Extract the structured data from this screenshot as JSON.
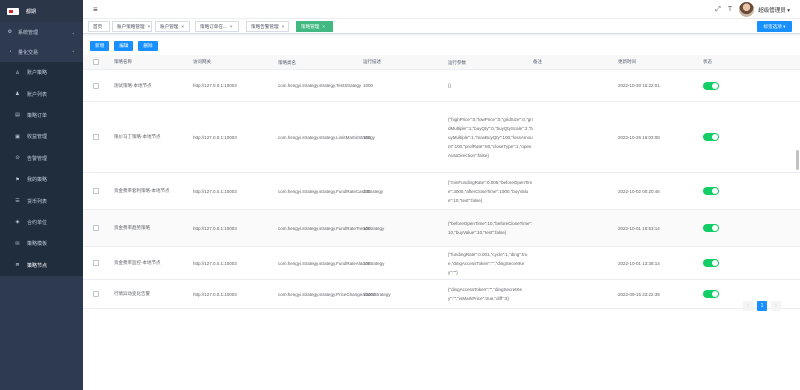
{
  "app": {
    "title": "都期"
  },
  "sidebar": {
    "groups": [
      {
        "label": "系统管理",
        "icon": "gear-icon"
      },
      {
        "label": "量化交易",
        "icon": "chart-icon"
      }
    ],
    "items": [
      {
        "label": "账户策略",
        "icon": "user-icon"
      },
      {
        "label": "账户列表",
        "icon": "user-list-icon"
      },
      {
        "label": "策略订单",
        "icon": "order-icon"
      },
      {
        "label": "收益管理",
        "icon": "money-icon"
      },
      {
        "label": "告警管理",
        "icon": "alarm-icon"
      },
      {
        "label": "我的策略",
        "icon": "strategy-icon"
      },
      {
        "label": "货币列表",
        "icon": "coin-icon"
      },
      {
        "label": "合约单位",
        "icon": "contract-icon"
      },
      {
        "label": "策略模板",
        "icon": "template-icon"
      },
      {
        "label": "策略节点",
        "icon": "node-icon"
      }
    ]
  },
  "navbar": {
    "username": "超级管理员",
    "user_arrow": "▾"
  },
  "tags": {
    "items": [
      {
        "label": "首页",
        "close": ""
      },
      {
        "label": "账户策略管理",
        "close": "×"
      },
      {
        "label": "账户管理",
        "close": "×"
      },
      {
        "label": "策略订单在...",
        "close": "×"
      },
      {
        "label": "策略告警管理",
        "close": "×"
      },
      {
        "label": "策略管理",
        "close": "×"
      }
    ],
    "select_label": "标签选项 ▾"
  },
  "toolbar": {
    "add": "新增",
    "edit": "编辑",
    "delete": "删除"
  },
  "table": {
    "headers": [
      "策略名称",
      "访问网关",
      "策略类名",
      "运行描述",
      "运行参数",
      "备注",
      "更新时间",
      "状态"
    ],
    "rows": [
      {
        "name": "测试策略-本地节点",
        "gateway": "http://127.0.0.1:10003",
        "clazz": "com.hengyi.strategy.strategy.TestStrategy",
        "desc": "1000",
        "params": "{}",
        "remark": "",
        "time": "2022-10-30 15:22:01"
      },
      {
        "name": "限价马丁策略-本地节点",
        "gateway": "http://127.0.0.1:10003",
        "clazz": "com.hengyi.strategy.strategy.LimitMartinStrategy",
        "desc": "100",
        "params": "{\"highPrice\":0,\"lowPrice\":0,\"gridSize\":0,\"gridMultiple\":1,\"buyQty\":0,\"buyQtyScale\":2,\"buyMultiple\":1,\"maxBuyQty\":100,\"lossAmount\":100,\"profRate\":50,\"closeType\":1,\"openAutoDirection\":false}",
        "remark": "",
        "time": "2022-10-26 16:03:08"
      },
      {
        "name": "资金费率套利策略-本地节点",
        "gateway": "http://127.0.0.1:10003",
        "clazz": "com.hengyi.strategy.strategy.FundRateCashStrategy",
        "desc": "100",
        "params": "{\"minFundingRate\":0.005,\"beforeOpenTime\":3000,\"afterCloseTime\":1000,\"buyValue\":10,\"test\":false}",
        "remark": "",
        "time": "2022-10-02 00:20:46"
      },
      {
        "name": "资金费率趋势策略",
        "gateway": "http://127.0.0.1:10003",
        "clazz": "com.hengyi.strategy.strategy.FundRateTrendStrategy",
        "desc": "100",
        "params": "{\"beforeOpenTime\":10,\"beforeCloseTime\":10,\"buyValue\":10,\"test\":false}",
        "remark": "",
        "time": "2022-10-01 18:53:14"
      },
      {
        "name": "资金费率监控-本地节点",
        "gateway": "http://127.0.0.1:10003",
        "clazz": "com.hengyi.strategy.strategy.FundRateAlarmStrategy",
        "desc": "100",
        "params": "{\"fundingRate\":0.001,\"cycle\":1,\"ding\":true,\"dingAccessToken\":\"\",\"dingSecretKey\":\"\"}",
        "remark": "",
        "time": "2022-10-01 13:38:14"
      },
      {
        "name": "行情异动变化告警",
        "gateway": "http://127.0.0.1:10003",
        "clazz": "com.hengyi.strategy.strategy.PriceChangeAlarmStrategy",
        "desc": "10000",
        "params": "{\"dingAccessToken\":\"\",\"dingSecretKey\":\"\",\"isMarkPrice\":true,\"diff\":3}",
        "remark": "",
        "time": "2022-09-15 23:22:39"
      }
    ]
  },
  "pager": {
    "prev": "‹",
    "current": "1",
    "next": "›"
  }
}
